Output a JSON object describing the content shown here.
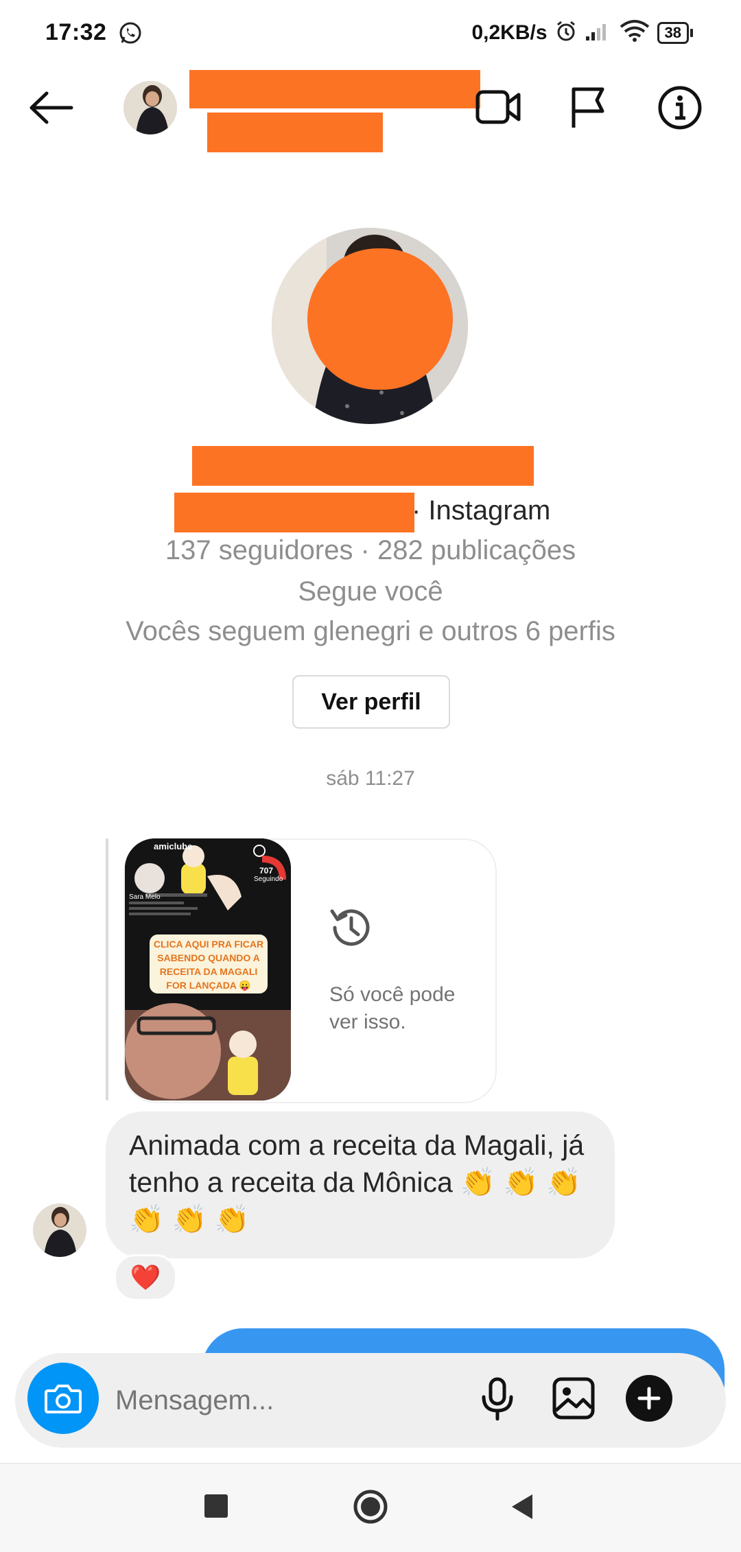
{
  "status_bar": {
    "time": "17:32",
    "network_speed": "0,2KB/s",
    "battery": "38"
  },
  "profile": {
    "source_suffix": "· Instagram",
    "stats": "137 seguidores · 282 publicações",
    "follows_you": "Segue você",
    "mutuals": "Vocês seguem glenegri e outros 6 perfis",
    "view_profile_label": "Ver perfil"
  },
  "chat": {
    "timestamp": "sáb 11:27",
    "story_reply_note": "Só você pode ver isso.",
    "story_thumbnail_texts": {
      "account": "amiclube",
      "count": "707",
      "following": "Seguindo",
      "name": "Sara Melo",
      "cta": "CLICA AQUI PRA FICAR SABENDO QUANDO A RECEITA DA MAGALI FOR LANÇADA 😛"
    },
    "received_message": "Animada com a receita da Magali, já tenho a receita da Mônica 👏 👏 👏 👏 👏 👏",
    "reaction": "❤️"
  },
  "composer": {
    "placeholder": "Mensagem..."
  },
  "colors": {
    "accent_blue": "#0095f6",
    "sent_bubble": "#3797f0",
    "redaction": "#fd7324",
    "heart": "#e0245e"
  }
}
